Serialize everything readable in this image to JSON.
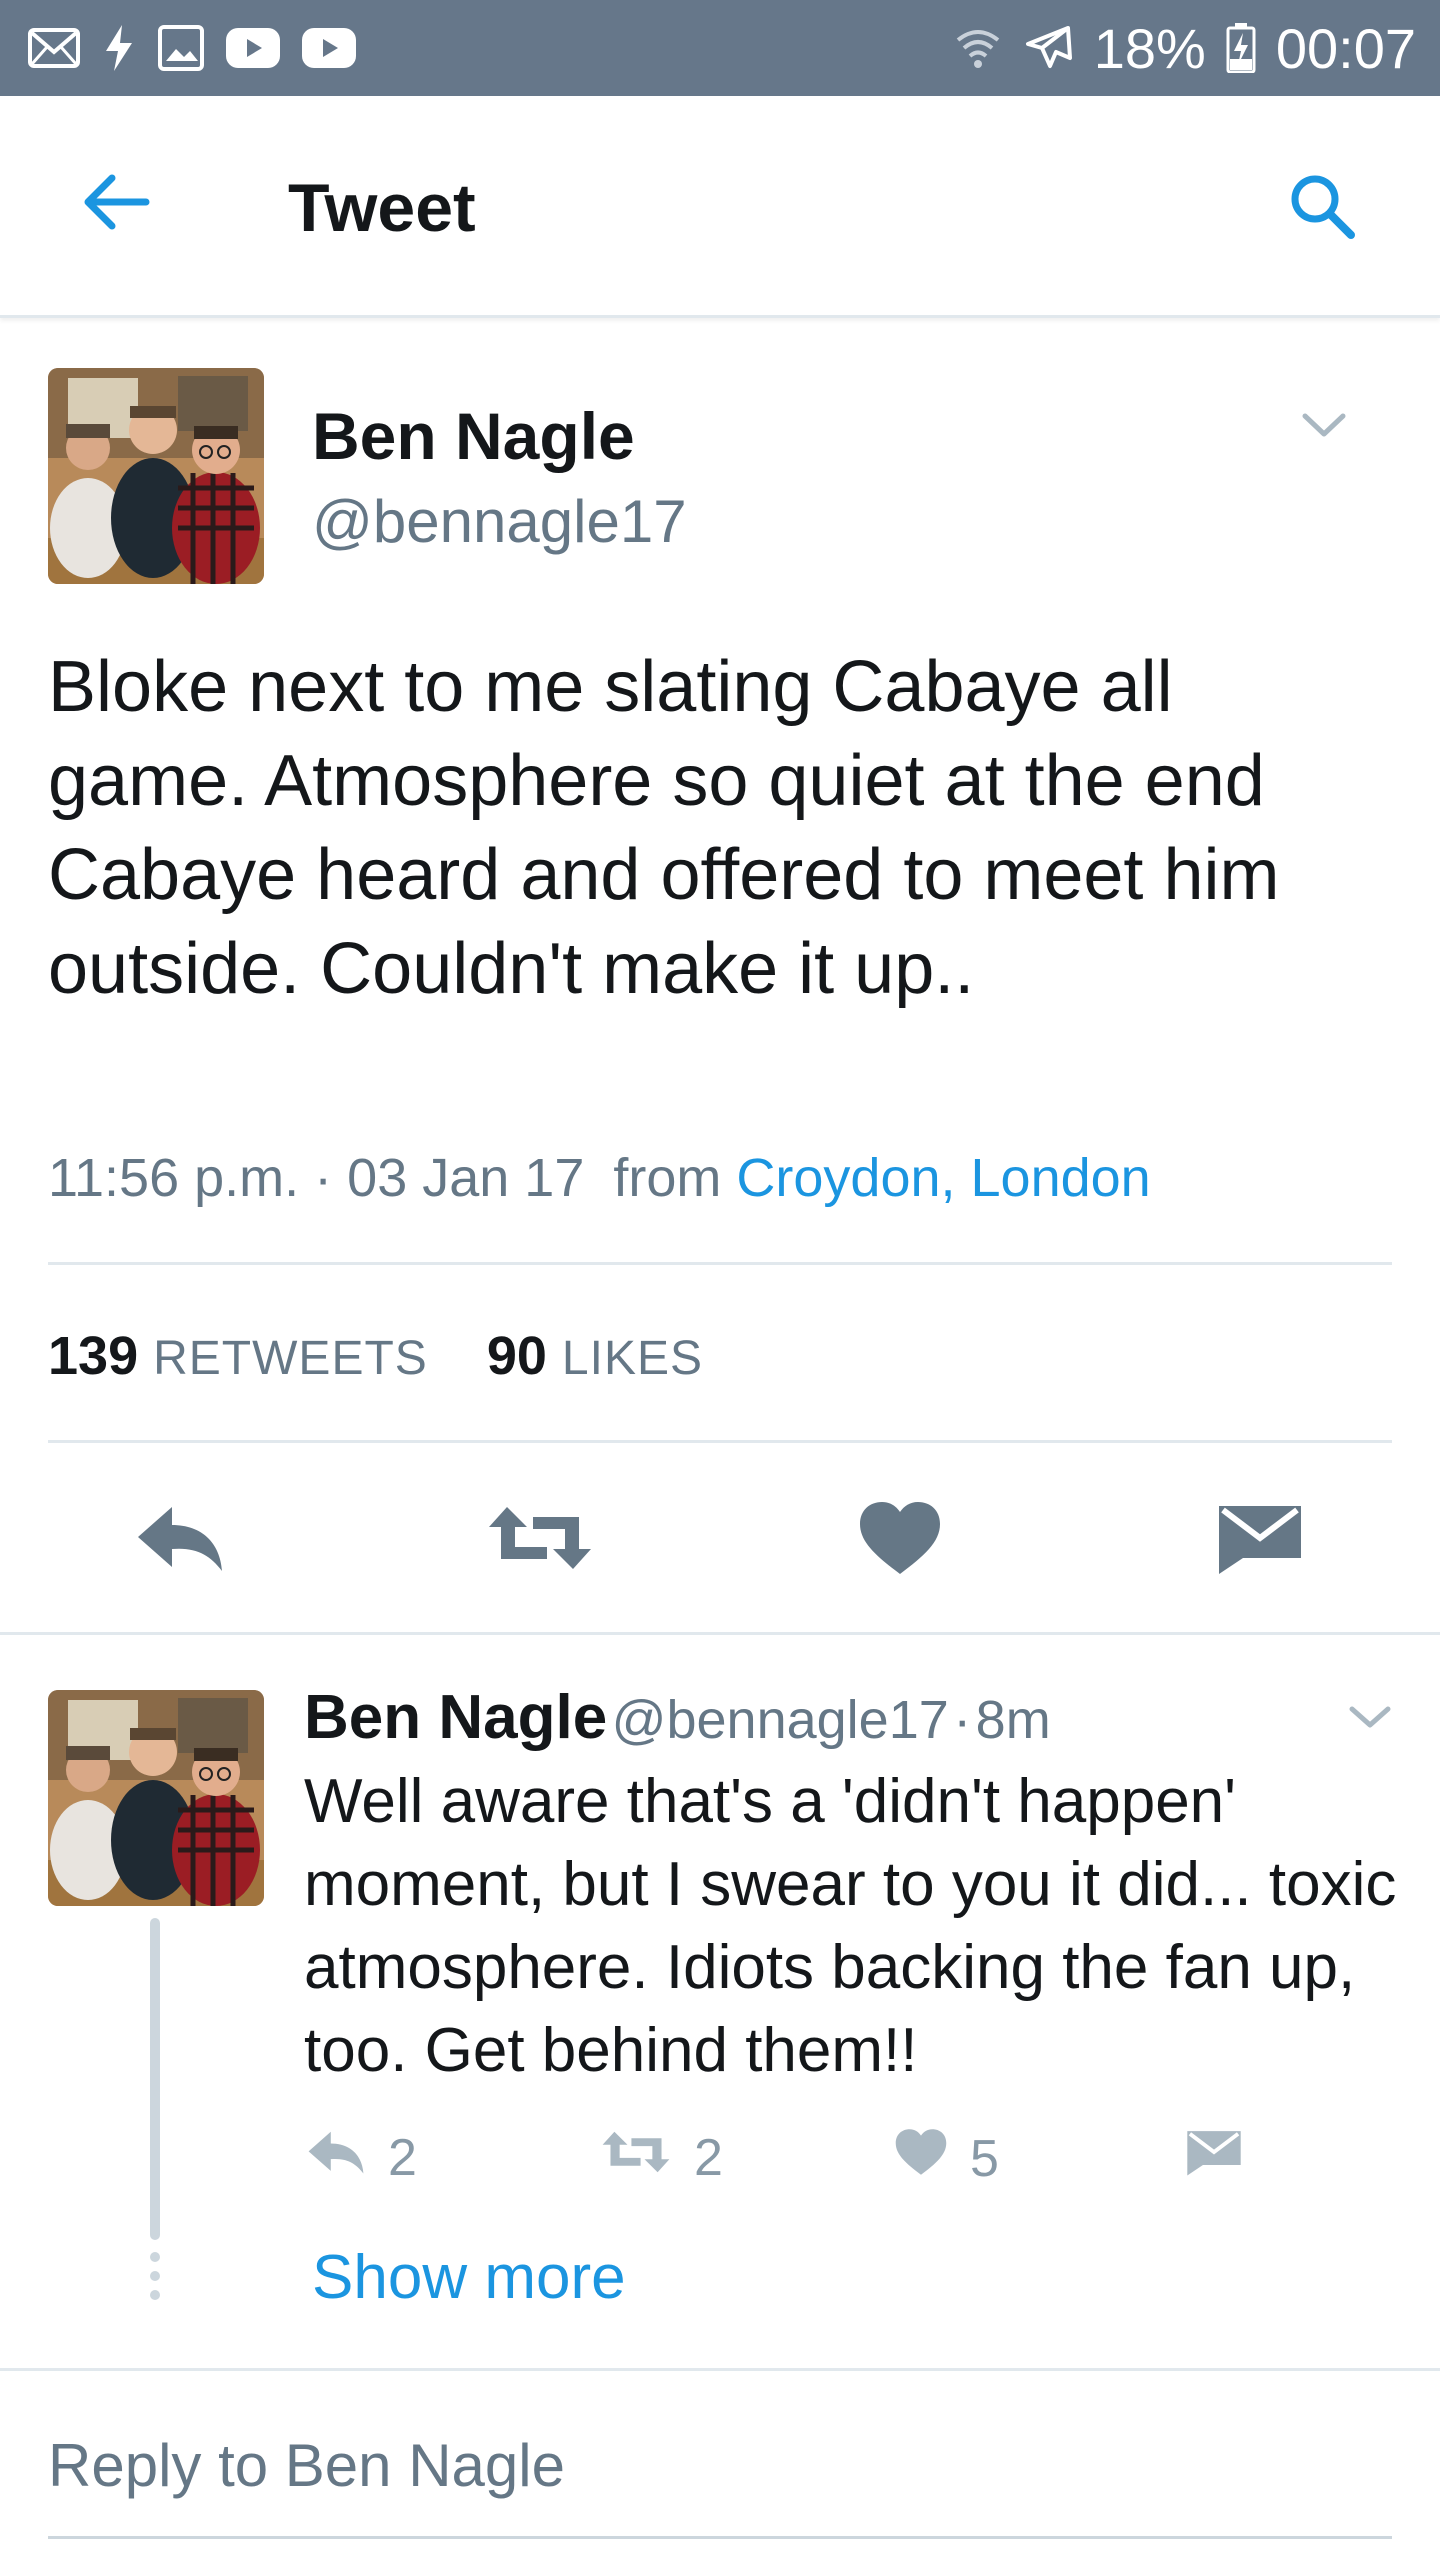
{
  "status_bar": {
    "battery": "18%",
    "time": "00:07",
    "icons": [
      "email-icon",
      "flash-icon",
      "gallery-icon",
      "youtube-icon",
      "youtube-icon",
      "wifi-icon",
      "airplane-mode-icon",
      "battery-charging-icon"
    ]
  },
  "app_bar": {
    "title": "Tweet",
    "icons": [
      "back-arrow-icon",
      "search-icon"
    ]
  },
  "main_tweet": {
    "author_name": "Ben Nagle",
    "author_handle": "@bennagle17",
    "text": "Bloke next to me slating Cabaye all game. Atmosphere so quiet at the end Cabaye heard and offered to meet him outside. Couldn't make it up..",
    "time": "11:56 p.m.",
    "separator": "·",
    "date": "03 Jan 17",
    "from_label": "from",
    "location": "Croydon, London",
    "retweets_count": "139",
    "retweets_label": "RETWEETS",
    "likes_count": "90",
    "likes_label": "LIKES",
    "actions": [
      "reply-icon",
      "retweet-icon",
      "like-icon",
      "direct-message-icon"
    ]
  },
  "reply_tweet": {
    "author_name": "Ben Nagle",
    "author_handle": "@bennagle17",
    "separator": "·",
    "age": "8m",
    "text": "Well aware that's a 'didn't happen' moment, but I swear to you it did... toxic atmosphere. Idiots backing the fan up, too. Get behind them!!",
    "reply_count": "2",
    "retweet_count": "2",
    "like_count": "5"
  },
  "show_more_label": "Show more",
  "reply_placeholder": "Reply to Ben Nagle",
  "colors": {
    "status_bar": "#66778a",
    "link_blue": "#1b95e0",
    "text_primary": "#14171a",
    "text_secondary": "#657786",
    "icon_gray": "#657786",
    "divider": "#e1e8ed"
  }
}
